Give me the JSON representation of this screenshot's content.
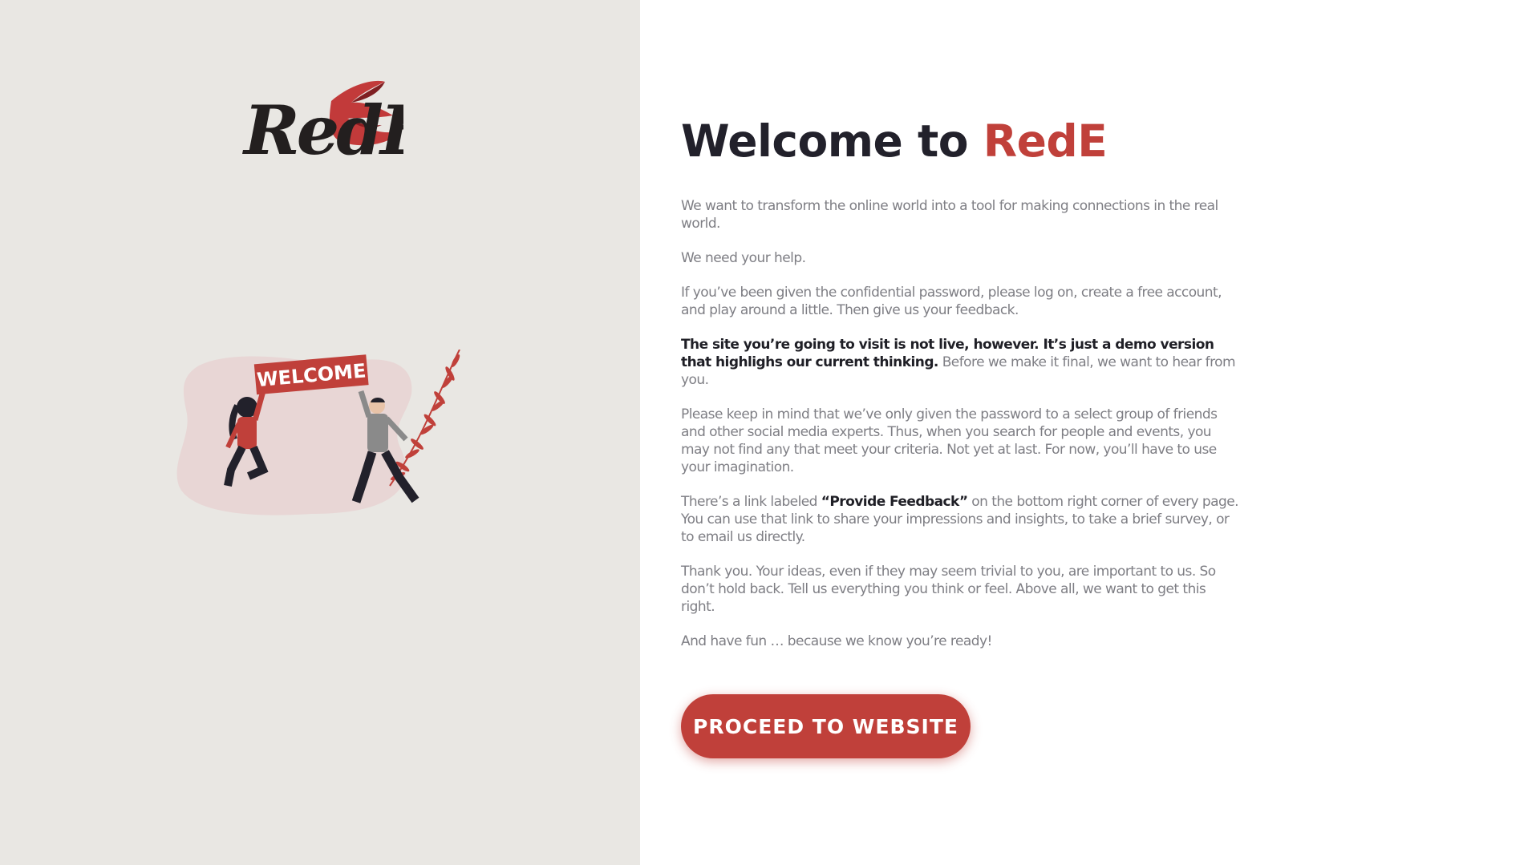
{
  "brand": {
    "logo_text": "RedE",
    "accent_color": "#c0403a",
    "dark_color": "#22212b"
  },
  "illustration": {
    "sign_text": "WELCOME"
  },
  "welcome": {
    "title_prefix": "Welcome to",
    "title_brand": "RedE"
  },
  "paragraphs": {
    "p1": "We want to transform the online world into a tool for making connections in the real world.",
    "p2": "We need your help.",
    "p3": "If you’ve been given the confidential password, please log on, create a free account, and play around a little. Then give us your feedback.",
    "p4_bold": "The site you’re going to visit is not live, however. It’s just a demo version that highlighs our current thinking.",
    "p4_rest": " Before we make it final, we want to hear from you.",
    "p5": "Please keep in mind that we’ve only given the password to a select group of friends and other social media experts. Thus, when you search for people and events, you may not find any that meet your criteria. Not yet at last. For now, you’ll have to use your imagination.",
    "p6_pre": "There’s a link labeled ",
    "p6_bold": "“Provide Feedback”",
    "p6_post": " on the bottom right corner of every page. You can use that link to share your impressions and insights, to take a brief survey, or to email us directly.",
    "p7": "Thank you. Your ideas, even if they may seem trivial to you, are important to us. So don’t hold back. Tell us everything you think or feel. Above all, we want to get this right.",
    "p8": "And have fun … because we know you’re ready!"
  },
  "cta": {
    "label": "PROCEED TO WEBSITE"
  }
}
